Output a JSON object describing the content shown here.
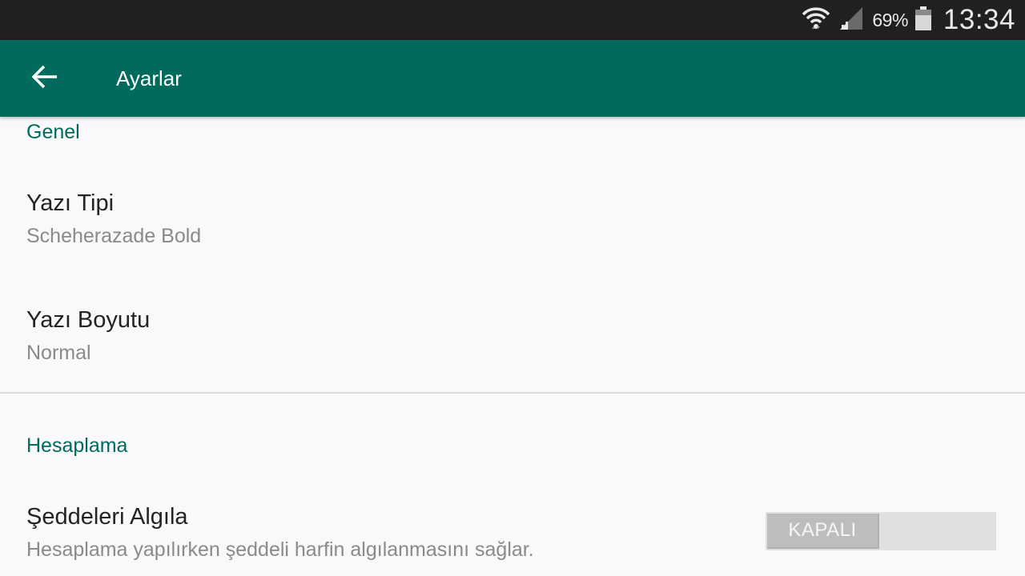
{
  "status_bar": {
    "battery_percent": "69%",
    "time": "13:34",
    "icons": [
      "wifi-icon",
      "signal-icon",
      "battery-icon"
    ]
  },
  "app_bar": {
    "title": "Ayarlar",
    "back_icon": "arrow-left-icon",
    "color": "#006a5c"
  },
  "sections": {
    "genel": {
      "header": "Genel",
      "font_type": {
        "title": "Yazı Tipi",
        "summary": "Scheherazade Bold"
      },
      "font_size": {
        "title": "Yazı Boyutu",
        "summary": "Normal"
      }
    },
    "hesaplama": {
      "header": "Hesaplama",
      "detect_shadda": {
        "title": "Şeddeleri Algıla",
        "summary": "Hesaplama yapılırken şeddeli harfin algılanmasını sağlar.",
        "toggle_label": "KAPALI",
        "toggle_on": false
      }
    }
  },
  "colors": {
    "accent": "#006a5c",
    "status_bar": "#221f22",
    "background": "#f9f8fb"
  }
}
